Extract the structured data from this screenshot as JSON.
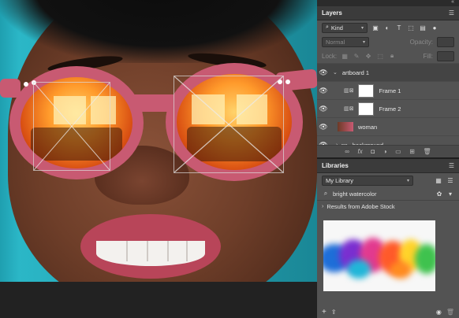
{
  "colors": {
    "panel_bg": "#535353",
    "panel_header": "#3b3b3b",
    "frame_pink": "#c85a72",
    "teal_background": "#2bb7c7"
  },
  "layers_panel": {
    "title": "Layers",
    "filter": {
      "value": "Kind"
    },
    "blend_mode": "Normal",
    "opacity_label": "Opacity:",
    "lock_label": "Lock:",
    "fill_label": "Fill:",
    "layers": [
      {
        "name": "artboard 1",
        "kind": "artboard",
        "icon": "chevron-down-icon"
      },
      {
        "name": "Frame 1",
        "kind": "frame",
        "icon": "frame-icon"
      },
      {
        "name": "Frame 2",
        "kind": "frame",
        "icon": "frame-icon"
      },
      {
        "name": "woman",
        "kind": "smart-object",
        "icon": "smart-object-icon"
      },
      {
        "name": "background",
        "kind": "group",
        "icon": "folder-icon"
      }
    ]
  },
  "libraries_panel": {
    "title": "Libraries",
    "library_select": "My Library",
    "search_value": "bright watercolor",
    "stock_heading": "Results from Adobe Stock"
  }
}
